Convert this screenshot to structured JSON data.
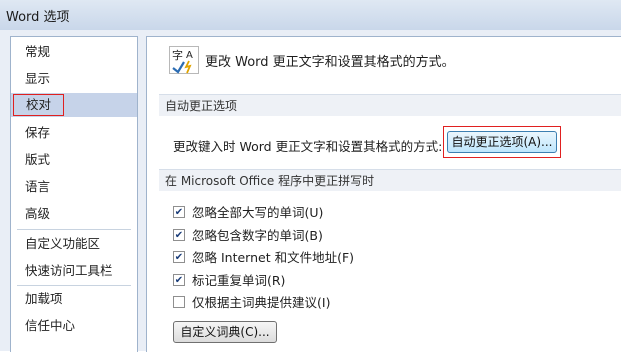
{
  "window": {
    "title": "Word 选项"
  },
  "sidebar": {
    "items": [
      {
        "label": "常规"
      },
      {
        "label": "显示"
      },
      {
        "label": "校对"
      },
      {
        "label": "保存"
      },
      {
        "label": "版式"
      },
      {
        "label": "语言"
      },
      {
        "label": "高级"
      },
      {
        "label": "自定义功能区"
      },
      {
        "label": "快速访问工具栏"
      },
      {
        "label": "加载项"
      },
      {
        "label": "信任中心"
      }
    ],
    "selected": "校对"
  },
  "header": {
    "text": "更改 Word 更正文字和设置其格式的方式。",
    "icon": "proofing-abc-check-icon"
  },
  "autocorrect_section": {
    "title": "自动更正选项",
    "description": "更改键入时 Word 更正文字和设置其格式的方式:",
    "button": "自动更正选项(A)..."
  },
  "spelling_section": {
    "title": "在 Microsoft Office 程序中更正拼写时",
    "checkboxes": [
      {
        "label": "忽略全部大写的单词(U)",
        "checked": true
      },
      {
        "label": "忽略包含数字的单词(B)",
        "checked": true
      },
      {
        "label": "忽略 Internet 和文件地址(F)",
        "checked": true
      },
      {
        "label": "标记重复单词(R)",
        "checked": true
      },
      {
        "label": "仅根据主词典提供建议(I)",
        "checked": false
      }
    ],
    "custom_dict_button": "自定义词典(C)..."
  }
}
